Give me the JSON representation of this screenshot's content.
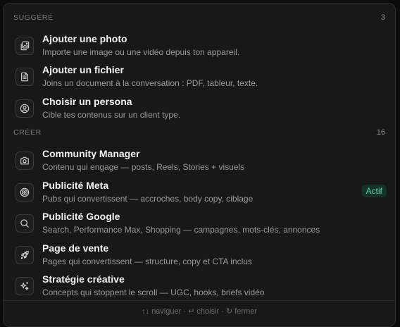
{
  "sections": [
    {
      "title": "SUGGÉRÉ",
      "count": "3",
      "items": [
        {
          "icon": "image-plus-icon",
          "title": "Ajouter une photo",
          "desc": "Importe une image ou une vidéo depuis ton appareil."
        },
        {
          "icon": "file-text-icon",
          "title": "Ajouter un fichier",
          "desc": "Joins un document à la conversation : PDF, tableur, texte."
        },
        {
          "icon": "user-circle-icon",
          "title": "Choisir un persona",
          "desc": "Cible tes contenus sur un client type."
        }
      ]
    },
    {
      "title": "CRÉER",
      "count": "16",
      "items": [
        {
          "icon": "camera-icon",
          "title": "Community Manager",
          "desc": "Contenu qui engage — posts, Reels, Stories + visuels"
        },
        {
          "icon": "target-icon",
          "title": "Publicité Meta",
          "desc": "Pubs qui convertissent — accroches, body copy, ciblage",
          "badge": "Actif"
        },
        {
          "icon": "search-icon",
          "title": "Publicité Google",
          "desc": "Search, Performance Max, Shopping — campagnes, mots-clés, annonces"
        },
        {
          "icon": "rocket-icon",
          "title": "Page de vente",
          "desc": "Pages qui convertissent — structure, copy et CTA inclus"
        },
        {
          "icon": "sparkles-icon",
          "title": "Stratégie créative",
          "desc": "Concepts qui stoppent le scroll — UGC, hooks, briefs vidéo"
        }
      ]
    }
  ],
  "footer": {
    "navigate_symbol": "↑↓",
    "navigate_label": "naviguer",
    "separator": "·",
    "choose_symbol": "↵",
    "choose_label": "choisir",
    "close_symbol": "↻",
    "close_label": "fermer"
  },
  "colors": {
    "background": "#181818",
    "badge_bg": "#14322b",
    "badge_text": "#5fd1a8"
  }
}
